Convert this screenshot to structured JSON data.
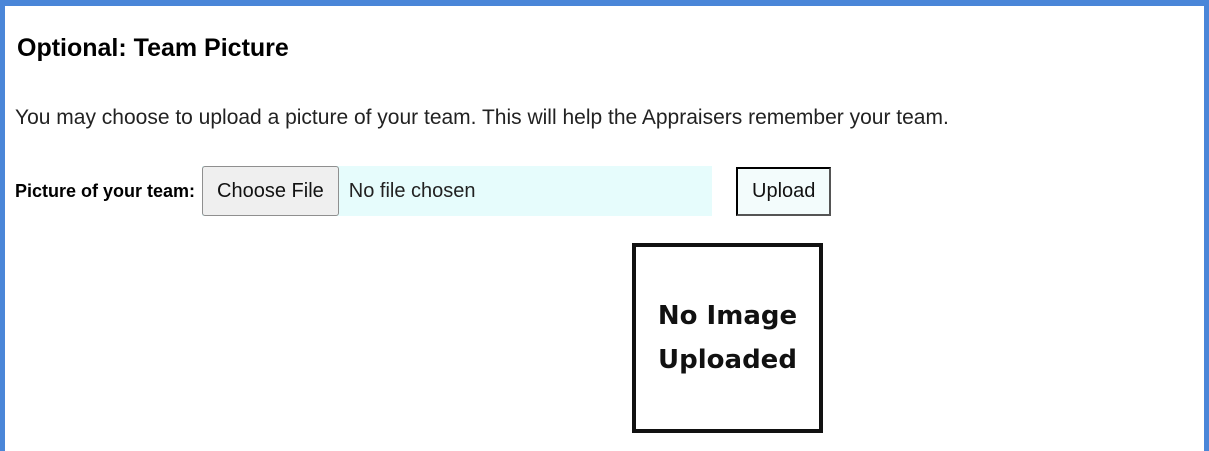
{
  "section": {
    "title": "Optional: Team Picture",
    "description": "You may choose to upload a picture of your team. This will help the Appraisers remember your team."
  },
  "upload_field": {
    "label": "Picture of your team:",
    "choose_label": "Choose File",
    "status": "No file chosen",
    "upload_label": "Upload"
  },
  "preview": {
    "line1": "No Image",
    "line2": "Uploaded"
  },
  "colors": {
    "accent_border": "#4a86d8",
    "file_widget_bg": "#e6fcfc"
  }
}
